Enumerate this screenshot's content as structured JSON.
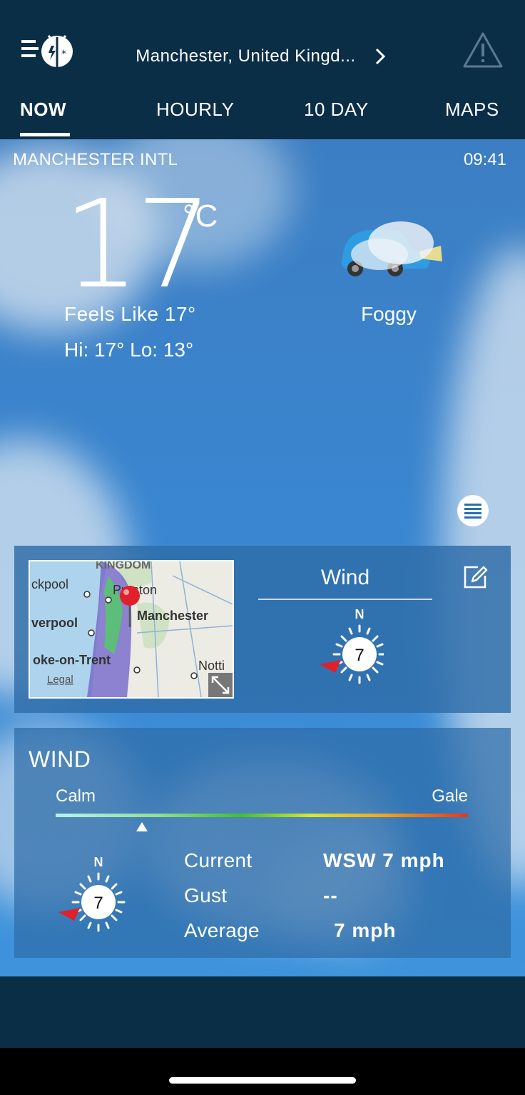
{
  "header": {
    "location": "Manchester, United Kingd...",
    "menu_icon": "menu-icon",
    "logo_icon": "weatherbug-logo-icon",
    "chevron_icon": "chevron-right-icon",
    "alert_icon": "alert-triangle-icon"
  },
  "tabs": [
    {
      "label": "NOW",
      "active": true
    },
    {
      "label": "HOURLY",
      "active": false
    },
    {
      "label": "10 DAY",
      "active": false
    },
    {
      "label": "MAPS",
      "active": false
    }
  ],
  "current": {
    "station": "MANCHESTER INTL",
    "time": "09:41",
    "temperature": "17",
    "unit": "°C",
    "feels_like": "Feels Like 17°",
    "hi_lo": "Hi: 17° Lo: 13°",
    "condition": "Foggy",
    "condition_icon": "fog-car-icon"
  },
  "summary_card": {
    "map": {
      "labels": [
        "KINGDOM",
        "ckpool",
        "Preston",
        "Manchester",
        "verpool",
        "oke-on-Trent",
        "Notti"
      ],
      "legal": "Legal",
      "expand_icon": "expand-icon",
      "pin_icon": "map-pin-icon"
    },
    "wind_title": "Wind",
    "edit_icon": "edit-icon",
    "compass": {
      "north": "N",
      "speed": "7"
    }
  },
  "wind_card": {
    "heading": "WIND",
    "scale_min": "Calm",
    "scale_max": "Gale",
    "scale_level": 0.21,
    "compass": {
      "north": "N",
      "speed": "7"
    },
    "rows": [
      {
        "label": "Current",
        "value": "WSW 7 mph"
      },
      {
        "label": "Gust",
        "value": "--"
      },
      {
        "label": "Average",
        "value": "7 mph"
      }
    ]
  },
  "colors": {
    "header": "#0b2e47",
    "sky": "#3a86d0",
    "card": "#2e6ca8",
    "arrow": "#e0202a"
  }
}
